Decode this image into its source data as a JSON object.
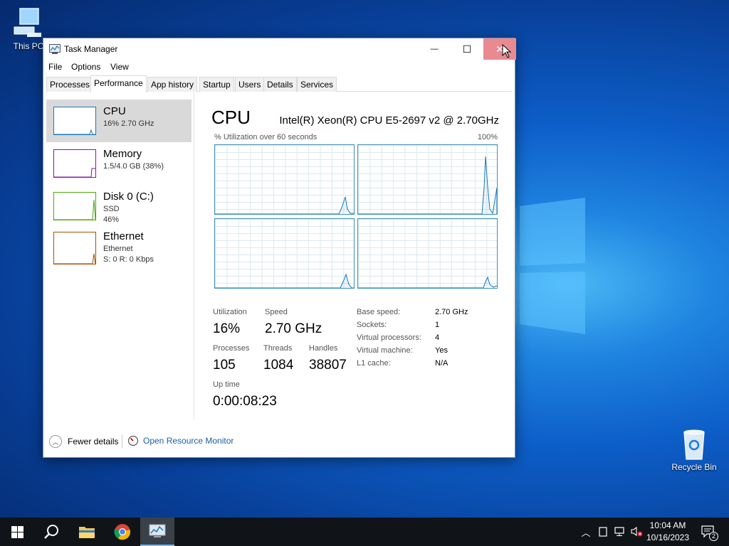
{
  "desktop": {
    "this_pc_label": "This PC",
    "recycle_bin_label": "Recycle Bin"
  },
  "window": {
    "title": "Task Manager",
    "minimize_glyph": "—",
    "maximize_glyph": "☐",
    "close_glyph": "✕"
  },
  "menu": [
    "File",
    "Options",
    "View"
  ],
  "tabs": [
    "Processes",
    "Performance",
    "App history",
    "Startup",
    "Users",
    "Details",
    "Services"
  ],
  "active_tab": "Performance",
  "resources": [
    {
      "name": "CPU",
      "line1": "16%  2.70 GHz",
      "line2": "",
      "color": "#1779ba"
    },
    {
      "name": "Memory",
      "line1": "1.5/4.0 GB (38%)",
      "line2": "",
      "color": "#8b12ae"
    },
    {
      "name": "Disk 0 (C:)",
      "line1": "SSD",
      "line2": "46%",
      "color": "#4da60c"
    },
    {
      "name": "Ethernet",
      "line1": "Ethernet",
      "line2": "S: 0  R: 0 Kbps",
      "color": "#a74f01"
    }
  ],
  "cpu": {
    "title": "CPU",
    "model": "Intel(R) Xeon(R) CPU E5-2697 v2 @ 2.70GHz",
    "graph_label": "% Utilization over 60 seconds",
    "graph_max": "100%",
    "stats": {
      "utilization_label": "Utilization",
      "utilization": "16%",
      "speed_label": "Speed",
      "speed": "2.70 GHz",
      "processes_label": "Processes",
      "processes": "105",
      "threads_label": "Threads",
      "threads": "1084",
      "handles_label": "Handles",
      "handles": "38807",
      "uptime_label": "Up time",
      "uptime": "0:00:08:23"
    },
    "specs": [
      {
        "label": "Base speed:",
        "value": "2.70 GHz"
      },
      {
        "label": "Sockets:",
        "value": "1"
      },
      {
        "label": "Virtual processors:",
        "value": "4"
      },
      {
        "label": "Virtual machine:",
        "value": "Yes"
      },
      {
        "label": "L1 cache:",
        "value": "N/A"
      }
    ]
  },
  "footer": {
    "fewer_details": "Fewer details",
    "open_resource_monitor": "Open Resource Monitor"
  },
  "taskbar": {
    "time": "10:04 AM",
    "date": "10/16/2023",
    "notification_count": "2"
  },
  "icons": [
    "windows-start-icon",
    "search-icon",
    "file-explorer-icon",
    "chrome-icon",
    "task-manager-icon",
    "chevron-up-icon",
    "tablet-icon",
    "network-icon",
    "volume-muted-icon",
    "action-center-icon"
  ]
}
